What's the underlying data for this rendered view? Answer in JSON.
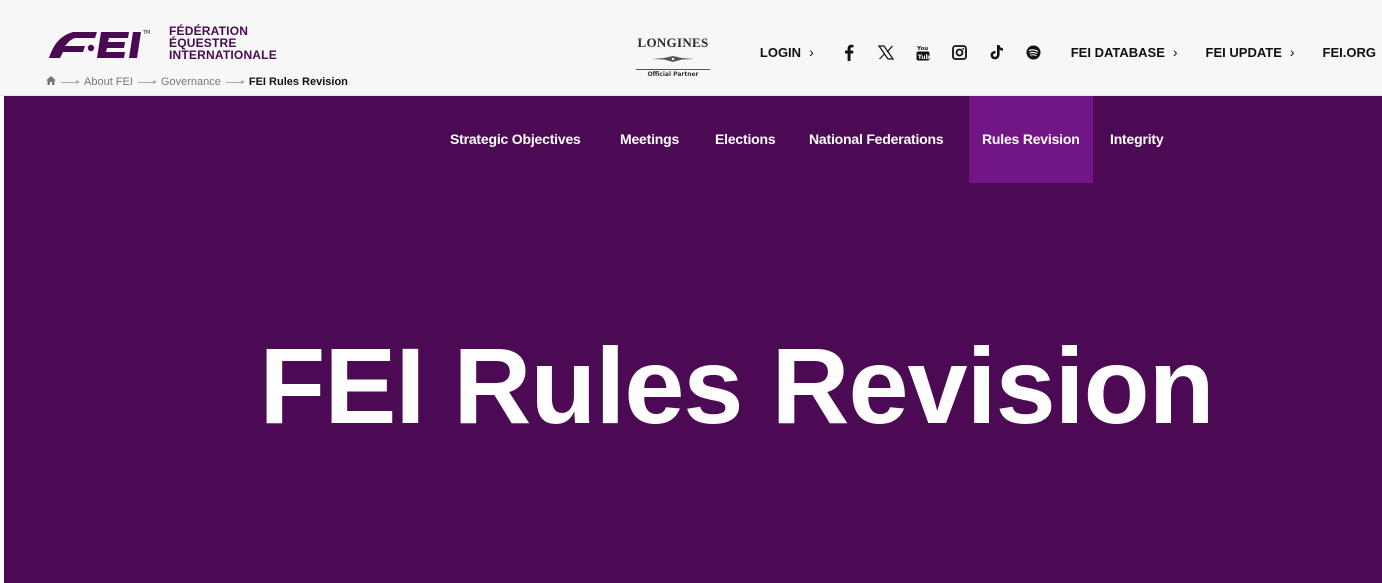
{
  "brand": {
    "logo_text_line1": "FÉDÉRATION",
    "logo_text_line2": "ÉQUESTRE",
    "logo_text_line3": "INTERNATIONALE",
    "primary_color": "#4c0a55",
    "active_color": "#731685"
  },
  "breadcrumb": {
    "home_icon": "home-icon",
    "items": [
      "About FEI",
      "Governance",
      "FEI Rules Revision"
    ]
  },
  "partner": {
    "name": "LONGINES",
    "tagline": "Official Partner"
  },
  "topnav": {
    "login": "LOGIN",
    "social_icons": [
      "facebook-icon",
      "x-icon",
      "youtube-icon",
      "instagram-icon",
      "tiktok-icon",
      "spotify-icon"
    ],
    "database": "FEI DATABASE",
    "update": "FEI UPDATE",
    "org": "FEI.ORG"
  },
  "subnav": {
    "items": [
      {
        "label": "Strategic Objectives",
        "active": false
      },
      {
        "label": "Meetings",
        "active": false
      },
      {
        "label": "Elections",
        "active": false
      },
      {
        "label": "National Federations",
        "active": false
      },
      {
        "label": "Rules Revision",
        "active": true
      },
      {
        "label": "Integrity",
        "active": false
      }
    ]
  },
  "hero": {
    "title": "FEI Rules Revision"
  }
}
